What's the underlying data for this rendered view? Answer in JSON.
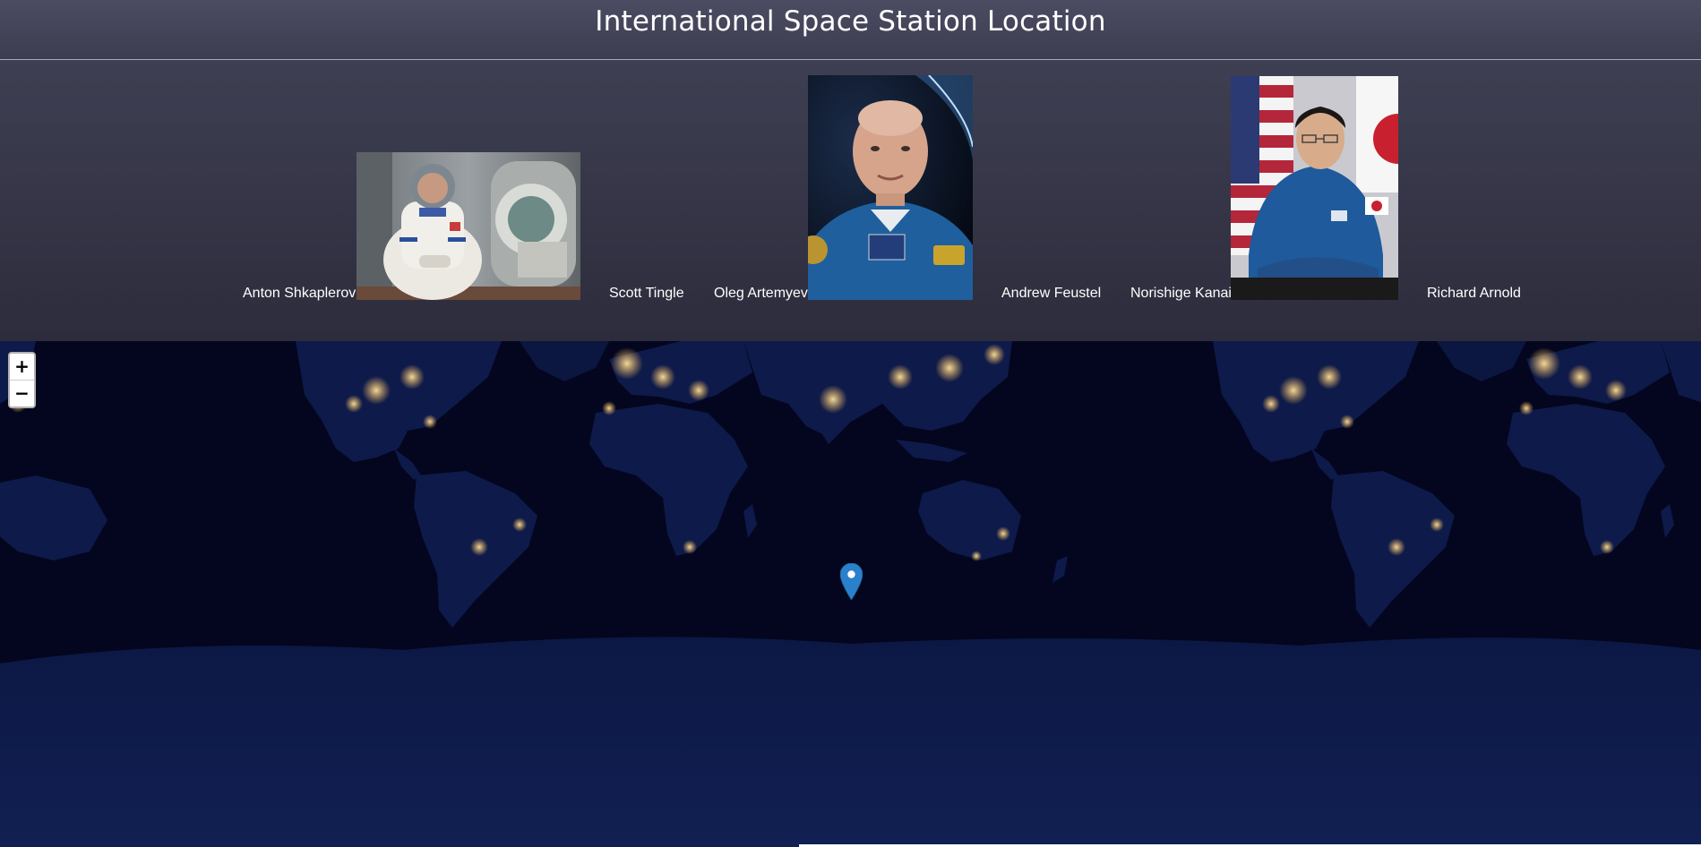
{
  "header": {
    "title": "International Space Station Location"
  },
  "crew": [
    {
      "name": "Anton Shkaplerov",
      "has_photo": true,
      "photo_subject": "astronaut-in-spacesuit-photo"
    },
    {
      "name": "Scott Tingle",
      "has_photo": false
    },
    {
      "name": "Oleg Artemyev",
      "has_photo": true,
      "photo_subject": "astronaut-portrait-photo"
    },
    {
      "name": "Andrew Feustel",
      "has_photo": false
    },
    {
      "name": "Norishige Kanai",
      "has_photo": true,
      "photo_subject": "astronaut-portrait-with-flags-photo"
    },
    {
      "name": "Richard Arnold",
      "has_photo": false
    }
  ],
  "map": {
    "zoom_in_label": "+",
    "zoom_out_label": "−",
    "marker_icon": "map-pin-icon",
    "marker_color": "#2a81cb",
    "ocean_color": "#03061e",
    "land_color": "#0d1a4a",
    "city_light_color": "#ffd27a"
  }
}
